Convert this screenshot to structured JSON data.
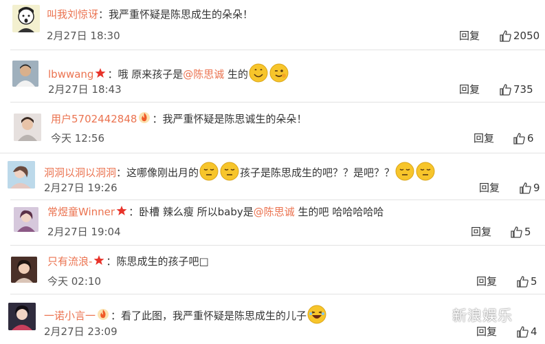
{
  "colors": {
    "username": "#eb7350",
    "text": "#333333",
    "meta": "#555555",
    "divider": "#e2e2e2",
    "emoji": "#f7c52b"
  },
  "comments": [
    {
      "username": "叫我刘惊讶",
      "badges": [],
      "sep": "：",
      "parts": [
        {
          "t": "我严重怀疑是陈思成生的朵朵！"
        }
      ],
      "time": "2月27日 18:30",
      "reply": "回复",
      "likes": "2050",
      "avatar": "cartoon-face"
    },
    {
      "username": "lbwwang",
      "badges": [
        "star-badge"
      ],
      "sep": "：",
      "parts": [
        {
          "t": "哦 原来孩子是"
        },
        {
          "m": "@陈思诚"
        },
        {
          "t": " 生的"
        },
        {
          "e": "smile"
        },
        {
          "e": "wink"
        }
      ],
      "time": "2月27日 18:43",
      "reply": "回复",
      "likes": "735",
      "avatar": "man-photo"
    },
    {
      "username": "用户5702442848",
      "badges": [
        "fire-badge"
      ],
      "sep": "：",
      "parts": [
        {
          "t": "我严重怀疑是陈思诚生的朵朵！"
        }
      ],
      "time": "今天 12:56",
      "reply": "回复",
      "likes": "6",
      "avatar": "person-photo"
    },
    {
      "username": "洞洞以洞以洞洞",
      "badges": [],
      "sep": "：",
      "parts": [
        {
          "t": "这哪像刚出月的"
        },
        {
          "e": "sleepy"
        },
        {
          "e": "sleepy"
        },
        {
          "t": "孩子是陈思成生的吧？？是吧？？"
        },
        {
          "e": "sleepy"
        },
        {
          "e": "sleepy"
        }
      ],
      "time": "2月27日 19:26",
      "reply": "回复",
      "likes": "9",
      "avatar": "girl-photo"
    },
    {
      "username": "常煜童Winner",
      "badges": [
        "star-badge"
      ],
      "sep": "：",
      "parts": [
        {
          "t": "卧槽 辣么瘦 所以baby是"
        },
        {
          "m": "@陈思诚"
        },
        {
          "t": " 生的吧 哈哈哈哈哈"
        }
      ],
      "time": "2月27日 19:04",
      "reply": "回复",
      "likes": "5",
      "avatar": "girl-photo-2"
    },
    {
      "username": "只有流浪-",
      "badges": [
        "star-badge"
      ],
      "sep": "：",
      "parts": [
        {
          "t": "陈思成生的孩子吧□"
        }
      ],
      "time": "今天 02:10",
      "reply": "回复",
      "likes": "5",
      "avatar": "woman-photo"
    },
    {
      "username": "一诺小言一",
      "badges": [
        "fire-badge"
      ],
      "sep": "：",
      "parts": [
        {
          "t": "看了此图，我严重怀疑是陈思成生的儿子"
        },
        {
          "e": "laugh"
        }
      ],
      "time": "2月27日 23:09",
      "reply": "回复",
      "likes": "4",
      "avatar": "woman-photo-2"
    }
  ],
  "watermark": {
    "text": "新浪娱乐",
    "icon": "wechat-icon"
  }
}
